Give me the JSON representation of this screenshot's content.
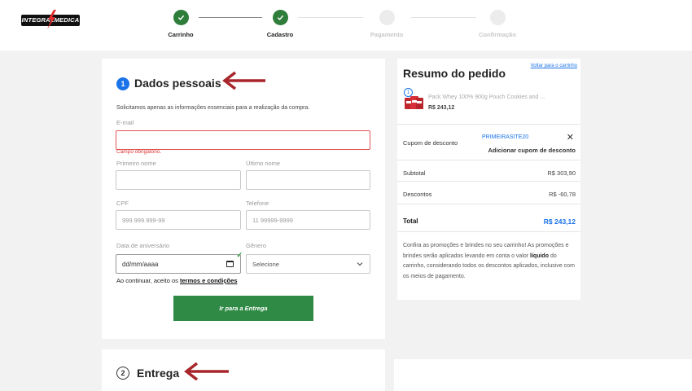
{
  "brand": {
    "logo_text": "INTEGRALMEDICA"
  },
  "stepper": {
    "steps": [
      {
        "label": "Carrinho",
        "state": "done"
      },
      {
        "label": "Cadastro",
        "state": "done"
      },
      {
        "label": "Pagamento",
        "state": "todo"
      },
      {
        "label": "Confirmação",
        "state": "todo"
      }
    ]
  },
  "personal": {
    "number": "1",
    "title": "Dados pessoais",
    "intro": "Solicitamos apenas as informações essenciais para a realização da compra.",
    "email": {
      "label": "E-mail",
      "value": "",
      "error": "Campo obrigatório."
    },
    "first_name": {
      "label": "Primeiro nome",
      "value": ""
    },
    "last_name": {
      "label": "Último nome",
      "value": ""
    },
    "cpf": {
      "label": "CPF",
      "placeholder": "999.999.999-99"
    },
    "phone": {
      "label": "Telefone",
      "placeholder": "11 99999-9999"
    },
    "birthdate": {
      "label": "Data de aniversário",
      "placeholder": "dd/mm/aaaa"
    },
    "gender": {
      "label": "Gênero",
      "selected": "Selecione"
    },
    "terms_prefix": "Ao continuar, aceito os",
    "terms_link": "termos e condições",
    "submit_label": "Ir para a Entrega"
  },
  "delivery": {
    "number": "2",
    "title": "Entrega"
  },
  "summary": {
    "title": "Resumo do pedido",
    "back_link": "Voltar para o carrinho",
    "product": {
      "qty": "1",
      "name": "Pack Whey 100% 900g Pouch Cookies and ...",
      "price": "R$ 243,12"
    },
    "coupon": {
      "label": "Cupom de desconto",
      "code": "PRIMEIRASITE20",
      "add_label": "Adicionar cupom de desconto"
    },
    "subtotal": {
      "label": "Subtotal",
      "value": "R$ 303,90"
    },
    "discounts": {
      "label": "Descontos",
      "value": "R$ -60,78"
    },
    "total": {
      "label": "Total",
      "value": "R$ 243,12"
    },
    "promo": {
      "part1": "Confira as promoções e brindes no seu carrinho! As promoções e brindes serão aplicados levando em conta o valor",
      "bold": "líquido",
      "part2": "do carrinho, considerando todos os descontos aplicados, inclusive com os meios de pagamento."
    }
  },
  "colors": {
    "accent": "#1a73e8",
    "success": "#2f8a45",
    "error": "#e05555",
    "annotation_arrow": "#a8262b"
  }
}
